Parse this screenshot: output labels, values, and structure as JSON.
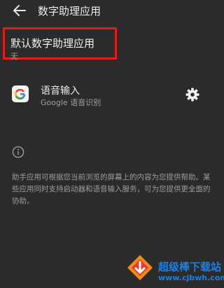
{
  "header": {
    "title": "数字助理应用",
    "back_icon": "arrow-left-icon"
  },
  "default_assistant": {
    "title": "默认数字助理应用",
    "value": "无",
    "highlight_color": "#e21b1b"
  },
  "assist_app": {
    "name": "语音输入",
    "subtitle": "Google 语音识别",
    "app_icon": "google-g-icon",
    "settings_icon": "gear-icon"
  },
  "info": {
    "icon": "info-icon",
    "text": "助手应用可根据您当前浏览的屏幕上的内容为您提供帮助。某些应用同时支持启动器和语音输入服务，可为您提供更全面的协助。"
  },
  "watermark": {
    "title": "超级棒下载站",
    "url": "www.cjbwh.com",
    "color": "#1f7fe0"
  }
}
